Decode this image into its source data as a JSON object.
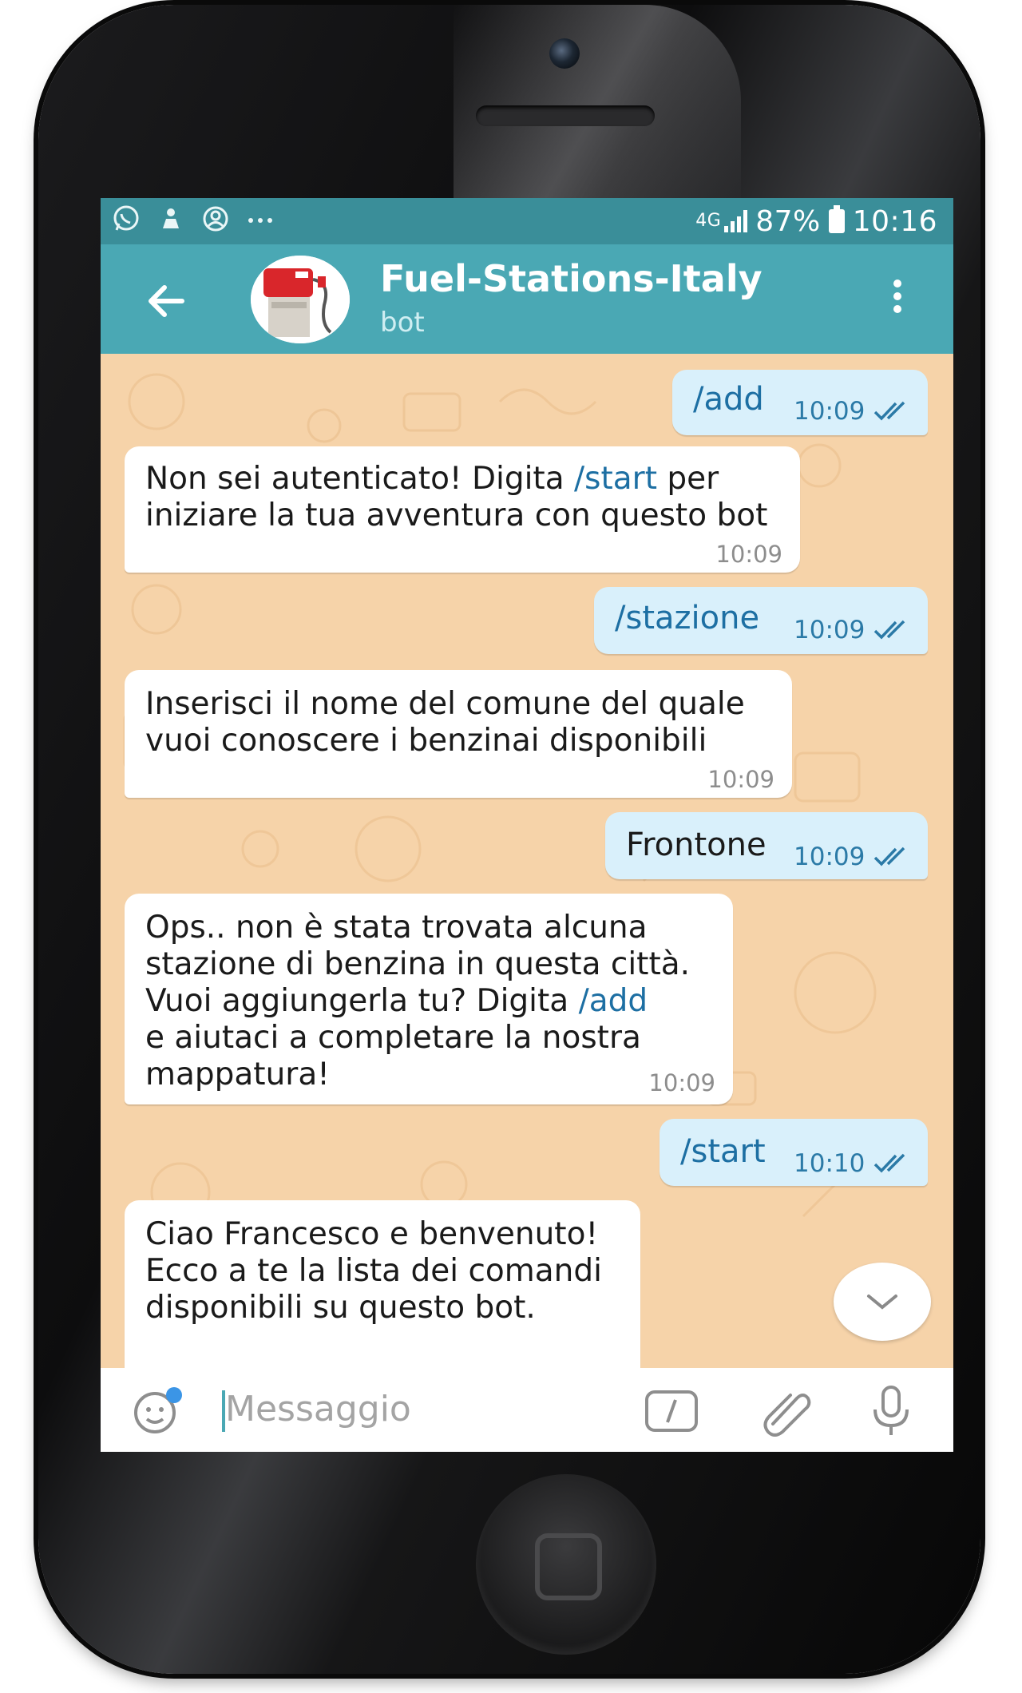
{
  "status_bar": {
    "network": "4G",
    "battery": "87%",
    "time": "10:16"
  },
  "header": {
    "title": "Fuel-Stations-Italy",
    "subtitle": "bot"
  },
  "messages": [
    {
      "dir": "out",
      "text": "/add",
      "time": "10:09"
    },
    {
      "dir": "in",
      "text_before": "Non sei autenticato! Digita ",
      "link": "/start",
      "text_after": " per\niniziare la tua avventura con questo bot",
      "time": "10:09"
    },
    {
      "dir": "out",
      "text": "/stazione",
      "time": "10:09"
    },
    {
      "dir": "in",
      "text": "Inserisci il nome del comune del quale\nvuoi conoscere i benzinai disponibili",
      "time": "10:09"
    },
    {
      "dir": "out",
      "text": "Frontone",
      "time": "10:09"
    },
    {
      "dir": "in",
      "text_before": "Ops.. non è stata trovata alcuna\nstazione di benzina in questa città.\nVuoi aggiungerla tu? Digita ",
      "link": "/add",
      "text_after": "\ne aiutaci a completare la nostra\nmappatura!",
      "time": "10:09"
    },
    {
      "dir": "out",
      "text": "/start",
      "time": "10:10"
    },
    {
      "dir": "in",
      "text": "Ciao Francesco e benvenuto!\nEcco a te la lista dei comandi\ndisponibili su questo bot."
    }
  ],
  "input": {
    "placeholder": "Messaggio"
  },
  "colors": {
    "header": "#4aa8b4",
    "status_bar": "#3a8e99",
    "chat_background": "#f6d3a9",
    "outgoing_bubble": "#d9f0fb",
    "incoming_bubble": "#ffffff",
    "link": "#1d6fa3"
  },
  "icons": [
    "whatsapp-icon",
    "notification-icon",
    "account-icon",
    "more-notifications-icon",
    "back-arrow-icon",
    "bot-avatar",
    "more-vert-icon",
    "double-check-icon",
    "chevron-down-icon",
    "emoji-icon",
    "bot-command-icon",
    "attachment-icon",
    "microphone-icon"
  ]
}
